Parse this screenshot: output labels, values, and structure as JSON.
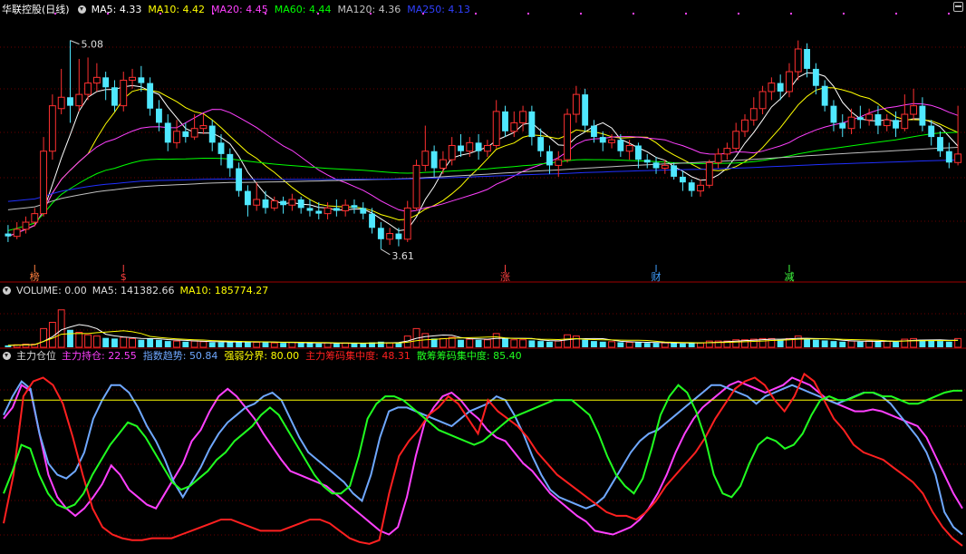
{
  "price_panel": {
    "title": "华联控股(日线)",
    "ma": [
      {
        "label": "MA5:",
        "value": "4.33",
        "color": "#ffffff"
      },
      {
        "label": "MA10:",
        "value": "4.42",
        "color": "#ffff00"
      },
      {
        "label": "MA20:",
        "value": "4.45",
        "color": "#ff40ff"
      },
      {
        "label": "MA60:",
        "value": "4.44",
        "color": "#00ff00"
      },
      {
        "label": "MA120:",
        "value": "4.36",
        "color": "#c0c0c0"
      },
      {
        "label": "MA250:",
        "value": "4.13",
        "color": "#0000ff"
      }
    ],
    "high_label": "5.08",
    "low_label": "3.61",
    "markers": [
      {
        "text": "榜",
        "color": "#ff8040",
        "i": 3
      },
      {
        "text": "$",
        "color": "#ff4040",
        "i": 13
      },
      {
        "text": "涨",
        "color": "#ff4040",
        "i": 56
      },
      {
        "text": "财",
        "color": "#40a0ff",
        "i": 73
      },
      {
        "text": "减",
        "color": "#40ff40",
        "i": 88
      }
    ]
  },
  "volume_panel": {
    "title": "VOLUME: 0.00",
    "ma5_label": "MA5:",
    "ma5_value": "141382.66",
    "ma10_label": "MA10:",
    "ma10_value": "185774.27"
  },
  "indicator_panel": {
    "title": "主力仓位",
    "items": [
      {
        "label": "主力持仓:",
        "value": "22.55",
        "color": "#ff40ff"
      },
      {
        "label": "指数趋势:",
        "value": "50.84",
        "color": "#6fa8ff"
      },
      {
        "label": "强弱分界:",
        "value": "80.00",
        "color": "#ffff00"
      },
      {
        "label": "主力筹码集中度:",
        "value": "48.31",
        "color": "#ff2020"
      },
      {
        "label": "散筹筹码集中度:",
        "value": "85.40",
        "color": "#20ff20"
      }
    ]
  },
  "chart_data": {
    "type": "candlestick",
    "ylim": [
      3.5,
      5.25
    ],
    "candles": [
      [
        3.72,
        3.7,
        3.78,
        3.66
      ],
      [
        3.7,
        3.75,
        3.8,
        3.68
      ],
      [
        3.75,
        3.8,
        3.84,
        3.72
      ],
      [
        3.8,
        3.86,
        3.9,
        3.77
      ],
      [
        3.86,
        4.3,
        4.4,
        3.84
      ],
      [
        4.3,
        4.62,
        4.7,
        4.24
      ],
      [
        4.6,
        4.68,
        4.88,
        4.56
      ],
      [
        4.68,
        4.62,
        5.08,
        4.5
      ],
      [
        4.62,
        4.7,
        4.95,
        4.58
      ],
      [
        4.7,
        4.78,
        4.96,
        4.66
      ],
      [
        4.78,
        4.82,
        4.92,
        4.72
      ],
      [
        4.82,
        4.75,
        4.86,
        4.66
      ],
      [
        4.75,
        4.62,
        4.8,
        4.58
      ],
      [
        4.62,
        4.8,
        4.86,
        4.58
      ],
      [
        4.8,
        4.82,
        4.88,
        4.74
      ],
      [
        4.82,
        4.78,
        4.9,
        4.72
      ],
      [
        4.78,
        4.6,
        4.82,
        4.55
      ],
      [
        4.6,
        4.5,
        4.66,
        4.44
      ],
      [
        4.5,
        4.36,
        4.56,
        4.3
      ],
      [
        4.36,
        4.44,
        4.52,
        4.32
      ],
      [
        4.44,
        4.4,
        4.5,
        4.36
      ],
      [
        4.4,
        4.46,
        4.56,
        4.38
      ],
      [
        4.46,
        4.48,
        4.56,
        4.42
      ],
      [
        4.48,
        4.36,
        4.52,
        4.3
      ],
      [
        4.36,
        4.28,
        4.42,
        4.2
      ],
      [
        4.28,
        4.18,
        4.32,
        4.12
      ],
      [
        4.18,
        4.02,
        4.22,
        3.98
      ],
      [
        4.02,
        3.92,
        4.06,
        3.84
      ],
      [
        3.92,
        3.96,
        4.08,
        3.88
      ],
      [
        3.96,
        3.9,
        4.02,
        3.86
      ],
      [
        3.9,
        3.95,
        3.98,
        3.88
      ],
      [
        3.95,
        3.92,
        3.98,
        3.86
      ],
      [
        3.92,
        3.96,
        4.0,
        3.88
      ],
      [
        3.96,
        3.9,
        3.98,
        3.86
      ],
      [
        3.9,
        3.88,
        3.96,
        3.84
      ],
      [
        3.88,
        3.86,
        3.94,
        3.82
      ],
      [
        3.86,
        3.9,
        3.94,
        3.82
      ],
      [
        3.9,
        3.88,
        3.96,
        3.84
      ],
      [
        3.88,
        3.92,
        3.96,
        3.84
      ],
      [
        3.92,
        3.9,
        3.96,
        3.86
      ],
      [
        3.9,
        3.86,
        3.94,
        3.82
      ],
      [
        3.86,
        3.76,
        3.9,
        3.72
      ],
      [
        3.76,
        3.68,
        3.8,
        3.61
      ],
      [
        3.68,
        3.72,
        3.76,
        3.64
      ],
      [
        3.72,
        3.68,
        3.76,
        3.63
      ],
      [
        3.68,
        3.9,
        3.95,
        3.66
      ],
      [
        3.9,
        4.2,
        4.24,
        3.88
      ],
      [
        4.2,
        4.3,
        4.48,
        4.16
      ],
      [
        4.3,
        4.18,
        4.34,
        4.12
      ],
      [
        4.18,
        4.24,
        4.3,
        4.14
      ],
      [
        4.24,
        4.34,
        4.4,
        4.2
      ],
      [
        4.34,
        4.3,
        4.42,
        4.26
      ],
      [
        4.3,
        4.36,
        4.4,
        4.26
      ],
      [
        4.36,
        4.3,
        4.42,
        4.24
      ],
      [
        4.3,
        4.34,
        4.38,
        4.26
      ],
      [
        4.34,
        4.58,
        4.66,
        4.32
      ],
      [
        4.58,
        4.44,
        4.62,
        4.4
      ],
      [
        4.44,
        4.5,
        4.58,
        4.4
      ],
      [
        4.5,
        4.58,
        4.62,
        4.44
      ],
      [
        4.58,
        4.4,
        4.62,
        4.34
      ],
      [
        4.4,
        4.3,
        4.46,
        4.26
      ],
      [
        4.3,
        4.2,
        4.34,
        4.14
      ],
      [
        4.2,
        4.24,
        4.3,
        4.12
      ],
      [
        4.24,
        4.56,
        4.6,
        4.22
      ],
      [
        4.56,
        4.7,
        4.76,
        4.5
      ],
      [
        4.7,
        4.48,
        4.74,
        4.44
      ],
      [
        4.48,
        4.4,
        4.52,
        4.36
      ],
      [
        4.4,
        4.36,
        4.44,
        4.3
      ],
      [
        4.36,
        4.38,
        4.42,
        4.32
      ],
      [
        4.38,
        4.3,
        4.42,
        4.26
      ],
      [
        4.3,
        4.34,
        4.38,
        4.24
      ],
      [
        4.34,
        4.24,
        4.36,
        4.18
      ],
      [
        4.24,
        4.22,
        4.28,
        4.18
      ],
      [
        4.22,
        4.18,
        4.26,
        4.14
      ],
      [
        4.18,
        4.2,
        4.24,
        4.14
      ],
      [
        4.2,
        4.12,
        4.22,
        4.1
      ],
      [
        4.12,
        4.08,
        4.16,
        4.02
      ],
      [
        4.08,
        4.02,
        4.1,
        3.98
      ],
      [
        4.02,
        4.06,
        4.1,
        3.98
      ],
      [
        4.06,
        4.22,
        4.24,
        4.04
      ],
      [
        4.22,
        4.28,
        4.32,
        4.18
      ],
      [
        4.28,
        4.32,
        4.36,
        4.24
      ],
      [
        4.32,
        4.44,
        4.5,
        4.3
      ],
      [
        4.44,
        4.52,
        4.56,
        4.4
      ],
      [
        4.52,
        4.6,
        4.68,
        4.48
      ],
      [
        4.6,
        4.72,
        4.76,
        4.56
      ],
      [
        4.72,
        4.78,
        4.82,
        4.66
      ],
      [
        4.78,
        4.72,
        4.84,
        4.66
      ],
      [
        4.72,
        4.86,
        4.92,
        4.68
      ],
      [
        4.86,
        5.02,
        5.08,
        4.8
      ],
      [
        5.02,
        4.88,
        5.06,
        4.82
      ],
      [
        4.88,
        4.76,
        4.92,
        4.7
      ],
      [
        4.76,
        4.62,
        4.8,
        4.58
      ],
      [
        4.62,
        4.5,
        4.66,
        4.44
      ],
      [
        4.5,
        4.46,
        4.56,
        4.4
      ],
      [
        4.46,
        4.54,
        4.6,
        4.42
      ],
      [
        4.54,
        4.52,
        4.62,
        4.46
      ],
      [
        4.52,
        4.56,
        4.6,
        4.48
      ],
      [
        4.56,
        4.48,
        4.62,
        4.42
      ],
      [
        4.48,
        4.52,
        4.56,
        4.44
      ],
      [
        4.52,
        4.46,
        4.58,
        4.4
      ],
      [
        4.46,
        4.56,
        4.7,
        4.44
      ],
      [
        4.56,
        4.62,
        4.74,
        4.52
      ],
      [
        4.62,
        4.48,
        4.68,
        4.44
      ],
      [
        4.48,
        4.4,
        4.52,
        4.34
      ],
      [
        4.4,
        4.3,
        4.44,
        4.26
      ],
      [
        4.3,
        4.22,
        4.36,
        4.18
      ],
      [
        4.22,
        4.28,
        4.62,
        4.2
      ]
    ],
    "volume": [
      3,
      4,
      5,
      5,
      30,
      40,
      60,
      28,
      24,
      20,
      18,
      15,
      14,
      16,
      14,
      12,
      14,
      12,
      10,
      10,
      9,
      10,
      9,
      8,
      8,
      8,
      10,
      9,
      8,
      8,
      7,
      7,
      8,
      7,
      7,
      6,
      7,
      6,
      7,
      6,
      6,
      8,
      9,
      7,
      8,
      18,
      30,
      22,
      14,
      14,
      16,
      12,
      13,
      12,
      12,
      22,
      14,
      12,
      12,
      11,
      10,
      9,
      10,
      20,
      18,
      12,
      10,
      9,
      9,
      8,
      8,
      8,
      7,
      7,
      7,
      7,
      6,
      7,
      7,
      10,
      10,
      10,
      12,
      12,
      13,
      14,
      14,
      12,
      14,
      18,
      14,
      12,
      11,
      10,
      9,
      10,
      9,
      10,
      9,
      10,
      9,
      13,
      14,
      12,
      11,
      10,
      9,
      14
    ],
    "volume_ylim": [
      0,
      80
    ],
    "indicator_ylim": [
      0,
      100
    ],
    "indicator_series": [
      {
        "name": "主力持仓",
        "color": "#ff40ff",
        "values": [
          70,
          76,
          88,
          85,
          62,
          40,
          28,
          22,
          18,
          22,
          28,
          35,
          45,
          40,
          32,
          28,
          24,
          22,
          30,
          38,
          46,
          58,
          64,
          74,
          82,
          86,
          82,
          76,
          70,
          62,
          55,
          48,
          42,
          40,
          38,
          36,
          34,
          30,
          26,
          22,
          18,
          14,
          10,
          8,
          12,
          28,
          50,
          68,
          76,
          82,
          84,
          80,
          74,
          70,
          64,
          60,
          58,
          52,
          46,
          42,
          36,
          30,
          26,
          22,
          18,
          15,
          10,
          9,
          8,
          10,
          12,
          16,
          22,
          30,
          40,
          52,
          62,
          70,
          76,
          80,
          84,
          88,
          90,
          88,
          86,
          84,
          86,
          88,
          92,
          90,
          88,
          84,
          80,
          78,
          76,
          74,
          74,
          75,
          74,
          72,
          70,
          68,
          66,
          60,
          50,
          40,
          30,
          22
        ]
      },
      {
        "name": "指数趋势",
        "color": "#6fa8ff",
        "values": [
          72,
          82,
          90,
          86,
          62,
          46,
          40,
          38,
          42,
          52,
          70,
          80,
          88,
          88,
          84,
          76,
          66,
          58,
          48,
          36,
          28,
          36,
          44,
          54,
          62,
          68,
          72,
          76,
          78,
          82,
          84,
          80,
          70,
          60,
          52,
          48,
          44,
          40,
          36,
          30,
          26,
          40,
          60,
          74,
          76,
          76,
          74,
          72,
          70,
          68,
          66,
          70,
          74,
          76,
          78,
          82,
          80,
          72,
          62,
          50,
          40,
          32,
          28,
          26,
          24,
          22,
          24,
          28,
          36,
          44,
          52,
          58,
          62,
          64,
          68,
          72,
          76,
          80,
          84,
          88,
          88,
          86,
          84,
          82,
          78,
          82,
          84,
          86,
          88,
          86,
          84,
          82,
          80,
          78,
          80,
          82,
          84,
          84,
          82,
          78,
          72,
          66,
          60,
          52,
          40,
          20,
          12,
          8
        ]
      },
      {
        "name": "强弱分界",
        "color": "#ffff00",
        "values": [
          80,
          80,
          80,
          80,
          80,
          80,
          80,
          80,
          80,
          80,
          80,
          80,
          80,
          80,
          80,
          80,
          80,
          80,
          80,
          80,
          80,
          80,
          80,
          80,
          80,
          80,
          80,
          80,
          80,
          80,
          80,
          80,
          80,
          80,
          80,
          80,
          80,
          80,
          80,
          80,
          80,
          80,
          80,
          80,
          80,
          80,
          80,
          80,
          80,
          80,
          80,
          80,
          80,
          80,
          80,
          80,
          80,
          80,
          80,
          80,
          80,
          80,
          80,
          80,
          80,
          80,
          80,
          80,
          80,
          80,
          80,
          80,
          80,
          80,
          80,
          80,
          80,
          80,
          80,
          80,
          80,
          80,
          80,
          80,
          80,
          80,
          80,
          80,
          80,
          80,
          80,
          80,
          80,
          80,
          80,
          80,
          80,
          80,
          80,
          80,
          80,
          80,
          80,
          80,
          80,
          80,
          80,
          80
        ]
      },
      {
        "name": "主力筹码集中度",
        "color": "#ff2020",
        "values": [
          14,
          40,
          82,
          90,
          92,
          88,
          78,
          60,
          40,
          22,
          12,
          8,
          6,
          5,
          5,
          6,
          6,
          6,
          8,
          10,
          12,
          14,
          16,
          16,
          14,
          12,
          10,
          10,
          10,
          12,
          14,
          16,
          16,
          14,
          10,
          6,
          4,
          3,
          5,
          30,
          50,
          58,
          64,
          72,
          76,
          82,
          78,
          70,
          62,
          80,
          74,
          70,
          66,
          60,
          52,
          46,
          40,
          36,
          32,
          28,
          24,
          20,
          18,
          18,
          16,
          20,
          26,
          34,
          40,
          46,
          52,
          60,
          70,
          78,
          86,
          90,
          92,
          88,
          80,
          74,
          82,
          94,
          90,
          80,
          70,
          64,
          56,
          52,
          50,
          48,
          44,
          40,
          36,
          30,
          20,
          12,
          6,
          2
        ]
      },
      {
        "name": "散筹筹码集中度",
        "color": "#20ff20",
        "values": [
          30,
          42,
          56,
          54,
          40,
          30,
          24,
          22,
          24,
          30,
          40,
          48,
          56,
          62,
          68,
          66,
          60,
          52,
          44,
          36,
          32,
          34,
          38,
          42,
          48,
          52,
          58,
          62,
          66,
          72,
          76,
          72,
          64,
          56,
          48,
          40,
          34,
          30,
          30,
          34,
          50,
          70,
          78,
          82,
          82,
          80,
          76,
          72,
          68,
          64,
          62,
          60,
          58,
          56,
          58,
          62,
          66,
          70,
          72,
          74,
          76,
          78,
          80,
          80,
          80,
          76,
          72,
          62,
          50,
          40,
          34,
          30,
          38,
          54,
          72,
          82,
          88,
          84,
          74,
          60,
          40,
          30,
          28,
          34,
          46,
          56,
          60,
          58,
          54,
          56,
          62,
          72,
          80,
          82,
          80,
          80,
          82,
          84,
          84,
          82,
          82,
          80,
          78,
          78,
          80,
          82,
          84,
          85,
          85
        ]
      }
    ]
  }
}
